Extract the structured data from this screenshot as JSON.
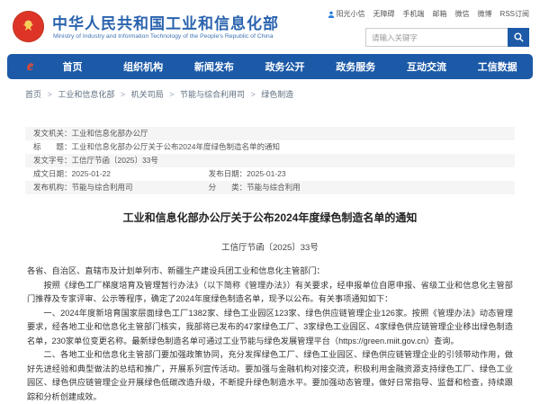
{
  "header": {
    "site_title": "中华人民共和国工业和信息化部",
    "site_subtitle": "Ministry of Industry and Information Technology of the People's Republic of China",
    "quick_links": [
      "阳光小信",
      "无障碍",
      "手机端",
      "邮箱",
      "微信",
      "微博",
      "RSS订阅"
    ],
    "search_placeholder": "请输入关键字"
  },
  "nav": {
    "items": [
      "首页",
      "组织机构",
      "新闻发布",
      "政务公开",
      "政务服务",
      "互动交流",
      "工信数据"
    ]
  },
  "breadcrumb": {
    "separator": ">",
    "items": [
      "首页",
      "工业和信息化部",
      "机关司局",
      "节能与综合利用司",
      "绿色制造"
    ]
  },
  "meta": {
    "rows": [
      {
        "label": "发文机关",
        "value": "工业和信息化部办公厅"
      },
      {
        "label": "标　　题",
        "value": "工业和信息化部办公厅关于公布2024年度绿色制造名单的通知"
      },
      {
        "label": "发文字号",
        "value": "工信厅节函〔2025〕33号"
      },
      {
        "label": "成文日期",
        "value": "2025-01-22",
        "label2": "发布日期",
        "value2": "2025-01-23"
      },
      {
        "label": "发布机构",
        "value": "节能与综合利用司",
        "label2": "分　　类",
        "value2": "节能与综合利用"
      }
    ]
  },
  "document": {
    "title": "工业和信息化部办公厅关于公布2024年度绿色制造名单的通知",
    "number": "工信厅节函〔2025〕33号",
    "paragraphs": [
      "各省、自治区、直辖市及计划单列市、新疆生产建设兵团工业和信息化主管部门：",
      "按照《绿色工厂梯度培育及管理暂行办法》（以下简称《管理办法》）有关要求，经申报单位自愿申报、省级工业和信息化主管部门推荐及专家评审、公示等程序，确定了2024年度绿色制造名单，现予以公布。有关事项通知如下：",
      "一、2024年度新培育国家层面绿色工厂1382家、绿色工业园区123家、绿色供应链管理企业126家。按照《管理办法》动态管理要求，经各地工业和信息化主管部门核实，我部将已发布的47家绿色工厂、3家绿色工业园区、4家绿色供应链管理企业移出绿色制造名单，230家单位变更名称。最新绿色制造名单可通过工业节能与绿色发展管理平台（https://green.miit.gov.cn）查询。",
      "二、各地工业和信息化主管部门要加强政策协同，充分发挥绿色工厂、绿色工业园区、绿色供应链管理企业的引领带动作用，做好先进经验和典型做法的总结和推广，开展系列宣传活动。要加强与金融机构对接交流，积极利用金融资源支持绿色工厂、绿色工业园区、绿色供应链管理企业开展绿色低碳改造升级，不断提升绿色制造水平。要加强动态管理，做好日常指导、监督和检查，持续跟踪和分析创建成效。"
    ]
  },
  "icons": {
    "emblem": "national-emblem",
    "search": "magnifier",
    "assistant": "person",
    "nav_logo": "miit-red-e"
  },
  "colors": {
    "nav_blue": "#1c5aa8",
    "title_blue": "#2a63ae",
    "logo_red": "#e8432e",
    "meta_row_gray": "#f5f5f5"
  }
}
